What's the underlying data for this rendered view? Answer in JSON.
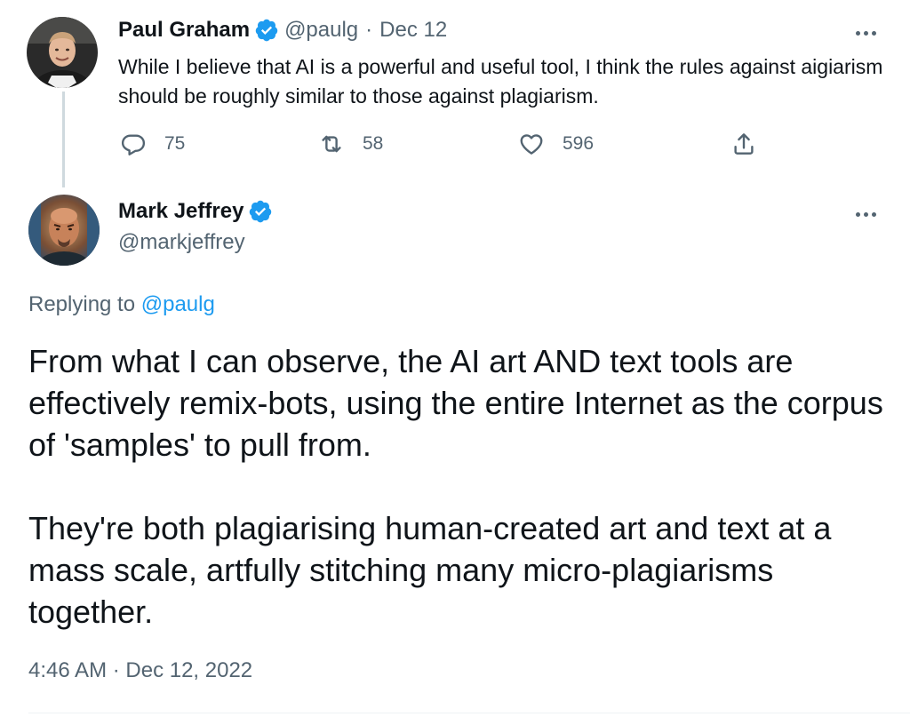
{
  "parent_tweet": {
    "author_name": "Paul Graham",
    "author_handle": "@paulg",
    "separator": "·",
    "date": "Dec 12",
    "text": "While I believe that AI is a powerful and useful tool, I think the rules against aigiarism should be roughly similar to those against plagiarism.",
    "verified": true,
    "actions": {
      "reply_count": "75",
      "retweet_count": "58",
      "like_count": "596"
    },
    "icons": [
      "verified-badge-icon",
      "more-options-icon",
      "reply-icon",
      "retweet-icon",
      "like-icon",
      "share-icon"
    ]
  },
  "main_tweet": {
    "author_name": "Mark Jeffrey",
    "author_handle": "@markjeffrey",
    "verified": true,
    "replying_prefix": "Replying to",
    "replying_handle": "@paulg",
    "paragraph_1": "From what I can observe, the AI art AND text tools are effectively remix-bots, using the entire Internet as the corpus of 'samples' to pull from.",
    "paragraph_2": "They're both plagiarising human-created art and text at a mass scale, artfully stitching many micro-plagiarisms together.",
    "timestamp": "4:46 AM · Dec 12, 2022"
  },
  "colors": {
    "text_primary": "#0f1419",
    "text_secondary": "#536471",
    "accent_blue": "#1d9bf0",
    "thread_line": "#cfd9de"
  }
}
